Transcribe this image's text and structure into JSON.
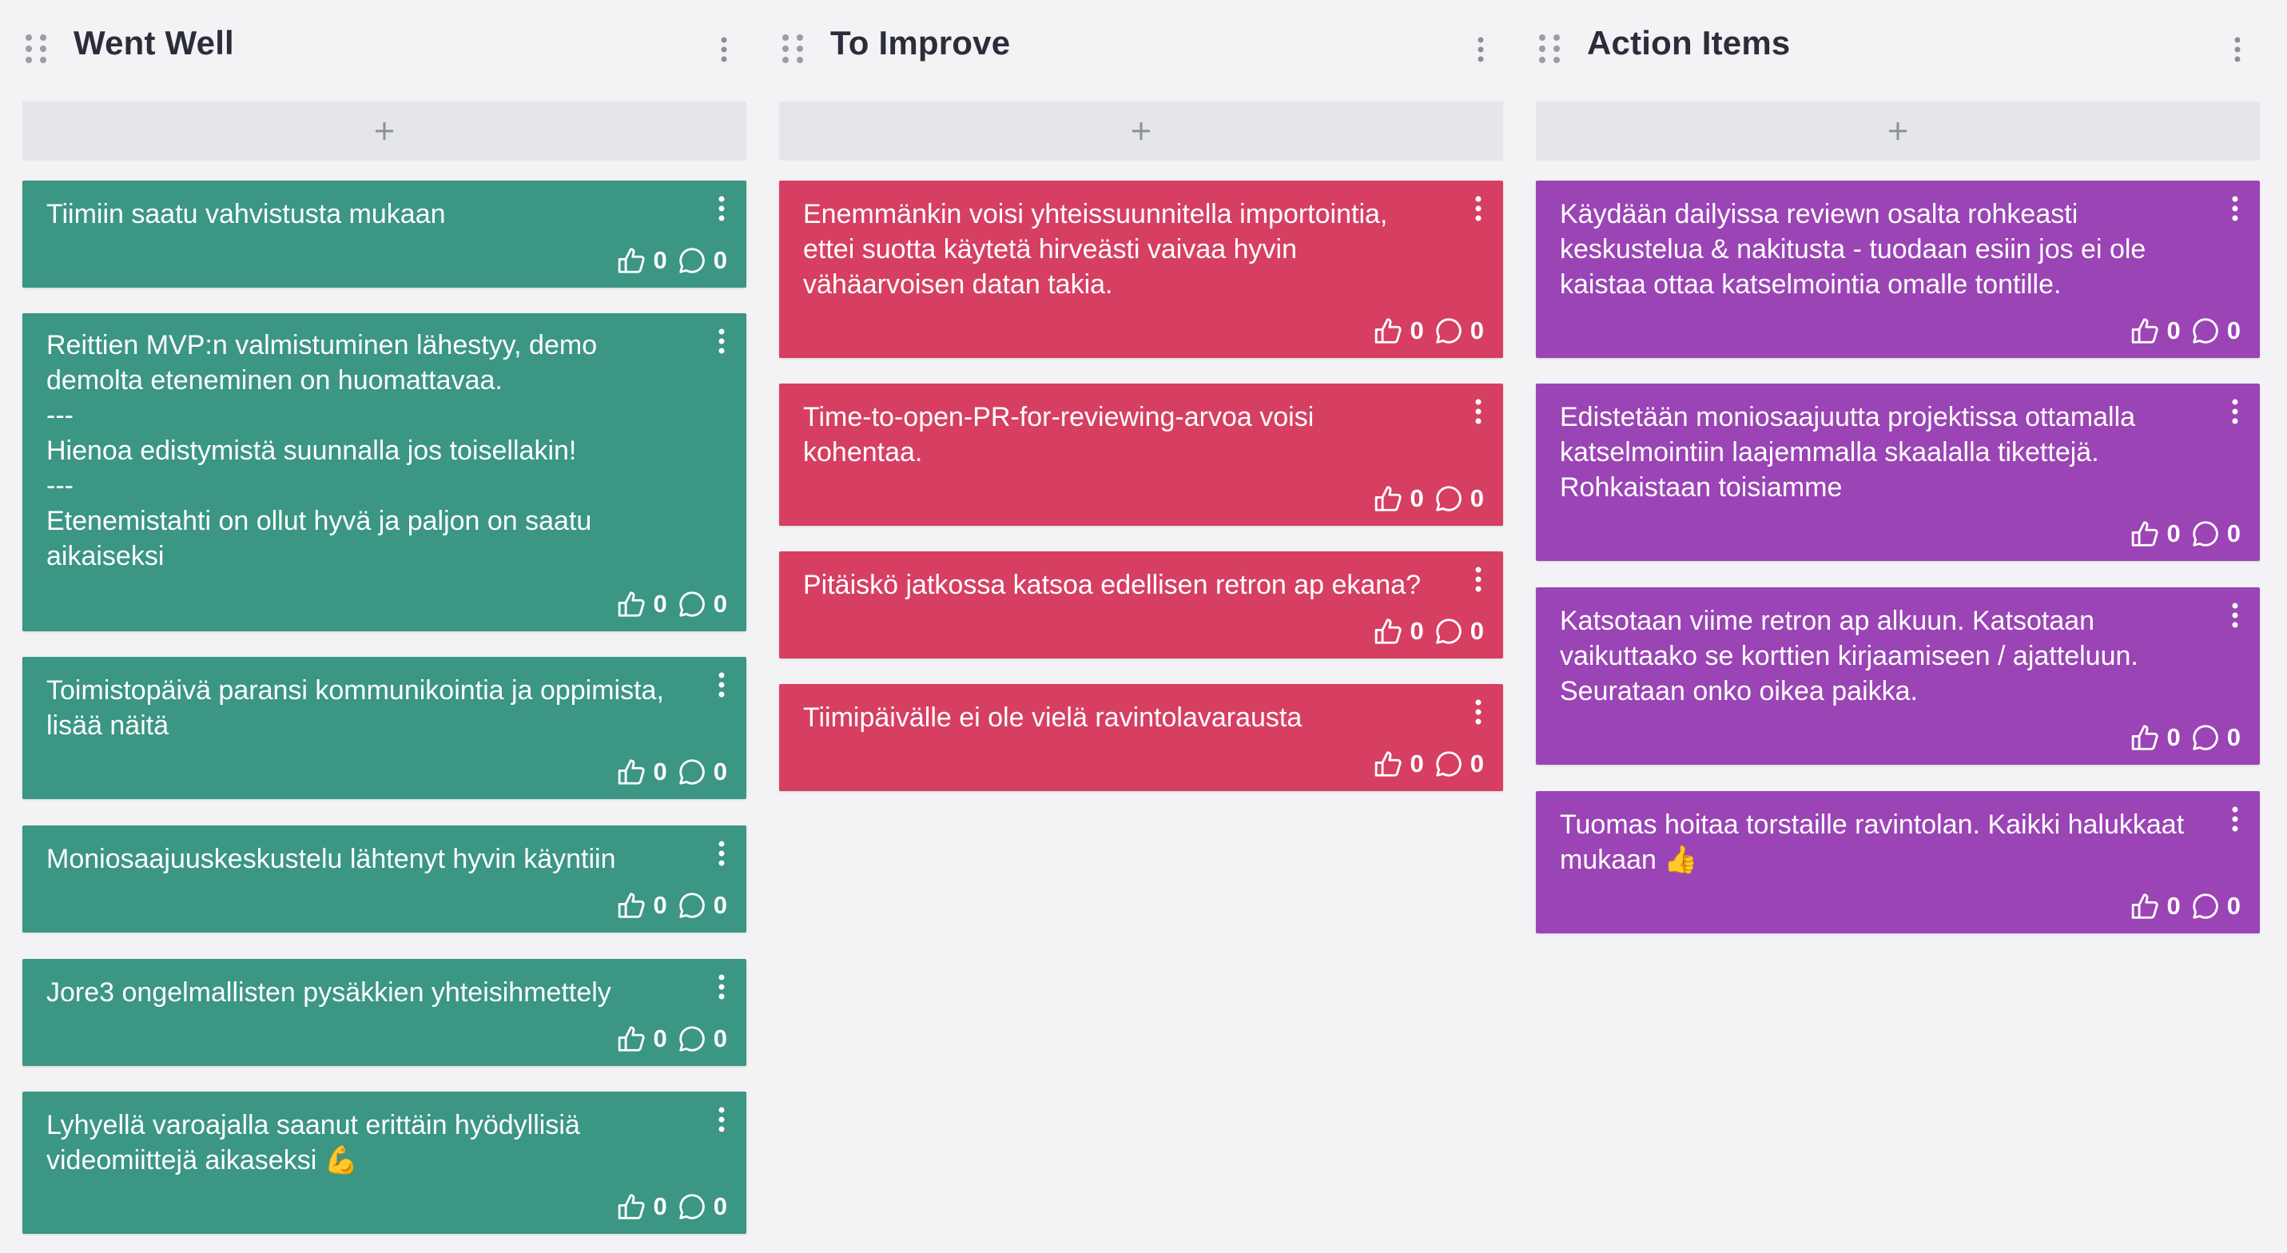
{
  "columns": [
    {
      "title": "Went Well",
      "color": "#3b9683",
      "add_icon": "plus-icon",
      "cards": [
        {
          "text": "Tiimiin saatu vahvistusta mukaan",
          "votes": "0",
          "comments": "0"
        },
        {
          "text": "Reittien MVP:n valmistuminen lähestyy, demo\ndemolta eteneminen on huomattavaa.\n---\nHienoa edistymistä suunnalla jos toisellakin!\n---\nEtenemistahti on ollut hyvä ja paljon on saatu\naikaiseksi",
          "votes": "0",
          "comments": "0"
        },
        {
          "text": "Toimistopäivä paransi kommunikointia ja oppimista,\nlisää näitä",
          "votes": "0",
          "comments": "0"
        },
        {
          "text": "Moniosaajuuskeskustelu lähtenyt hyvin käyntiin",
          "votes": "0",
          "comments": "0"
        },
        {
          "text": "Jore3 ongelmallisten pysäkkien yhteisihmettely",
          "votes": "0",
          "comments": "0"
        },
        {
          "text": "Lyhyellä varoajalla saanut erittäin hyödyllisiä\nvideomiittejä aikaseksi 💪",
          "votes": "0",
          "comments": "0"
        }
      ]
    },
    {
      "title": "To Improve",
      "color": "#d63f62",
      "add_icon": "plus-icon",
      "cards": [
        {
          "text": "Enemmänkin voisi yhteissuunnitella importointia,\nettei suotta käytetä hirveästi vaivaa hyvin\nvähäarvoisen datan takia.",
          "votes": "0",
          "comments": "0"
        },
        {
          "text": "Time-to-open-PR-for-reviewing-arvoa voisi\nkohentaa.",
          "votes": "0",
          "comments": "0"
        },
        {
          "text": "Pitäiskö jatkossa katsoa edellisen retron ap ekana?",
          "votes": "0",
          "comments": "0"
        },
        {
          "text": "Tiimipäivälle ei ole vielä ravintolavarausta",
          "votes": "0",
          "comments": "0"
        }
      ]
    },
    {
      "title": "Action Items",
      "color": "#9b44b5",
      "add_icon": "plus-icon",
      "cards": [
        {
          "text": "Käydään dailyissa reviewn osalta rohkeasti\nkeskustelua & nakitusta - tuodaan esiin jos ei ole\nkaistaa ottaa katselmointia omalle tontille.",
          "votes": "0",
          "comments": "0"
        },
        {
          "text": "Edistetään moniosaajuutta projektissa ottamalla\nkatselmointiin laajemmalla skaalalla tikettejä.\nRohkaistaan toisiamme",
          "votes": "0",
          "comments": "0"
        },
        {
          "text": "Katsotaan viime retron ap alkuun. Katsotaan\nvaikuttaako se korttien kirjaamiseen / ajatteluun.\nSeurataan onko oikea paikka.",
          "votes": "0",
          "comments": "0"
        },
        {
          "text": "Tuomas hoitaa torstaille ravintolan. Kaikki halukkaat\nmukaan 👍",
          "votes": "0",
          "comments": "0"
        }
      ]
    }
  ]
}
